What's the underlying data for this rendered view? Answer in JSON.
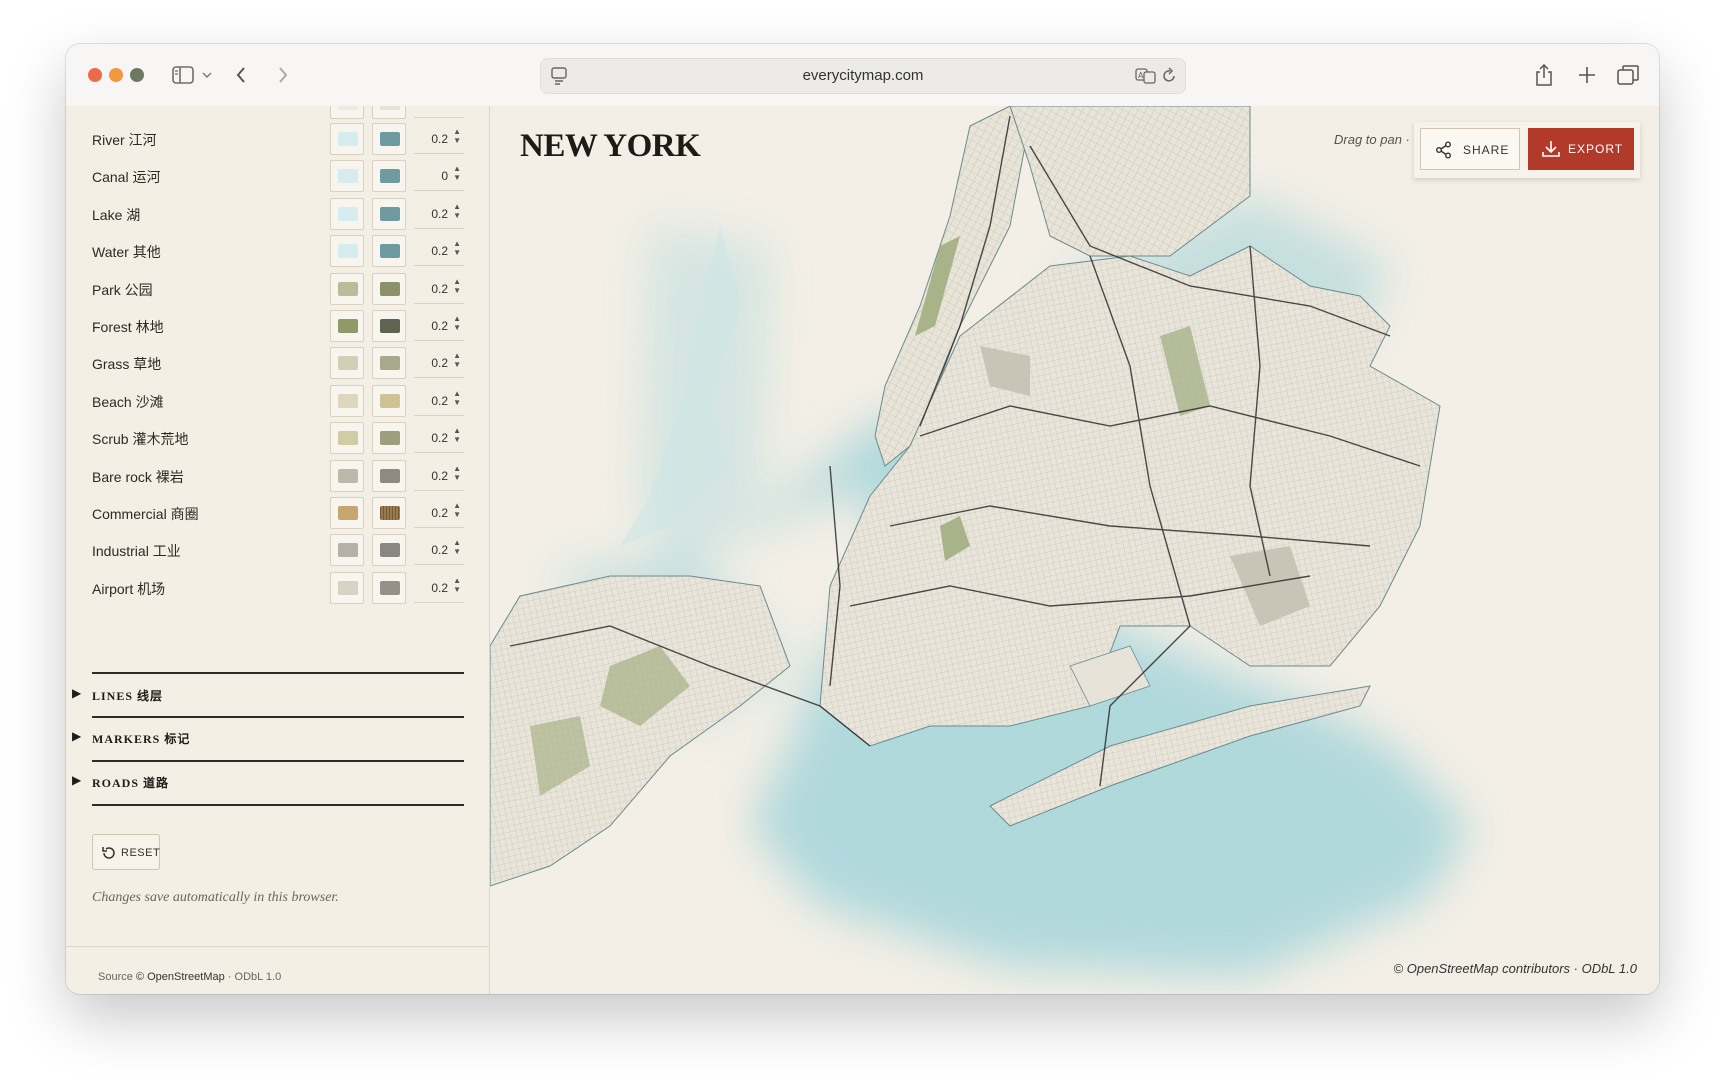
{
  "browser": {
    "url": "everycitymap.com",
    "traffic_colors": [
      "#ee6a4b",
      "#f1993c",
      "#6f7860"
    ]
  },
  "sidebar": {
    "layers": [
      {
        "label": "River 江河",
        "color1": "#d6ecee",
        "color2": "#6f9aa0",
        "value": "0.2"
      },
      {
        "label": "Canal 运河",
        "color1": "#d6ecee",
        "color2": "#6f9aa0",
        "value": "0"
      },
      {
        "label": "Lake 湖",
        "color1": "#d6ecee",
        "color2": "#6f9aa0",
        "value": "0.2"
      },
      {
        "label": "Water 其他",
        "color1": "#d6ecee",
        "color2": "#6f9aa0",
        "value": "0.2"
      },
      {
        "label": "Park 公园",
        "color1": "#b9be98",
        "color2": "#8b9269",
        "value": "0.2"
      },
      {
        "label": "Forest 林地",
        "color1": "#8f9a68",
        "color2": "#5f6350",
        "value": "0.2"
      },
      {
        "label": "Grass 草地",
        "color1": "#d1cfb5",
        "color2": "#a6a98a",
        "value": "0.2"
      },
      {
        "label": "Beach 沙滩",
        "color1": "#dfd6c0",
        "color2": "#cec394",
        "value": "0.2"
      },
      {
        "label": "Scrub 灌木荒地",
        "color1": "#cfcca6",
        "color2": "#9c9e7c",
        "value": "0.2"
      },
      {
        "label": "Bare rock 裸岩",
        "color1": "#bdb8ab",
        "color2": "#8e8a80",
        "value": "0.2"
      },
      {
        "label": "Commercial 商圈",
        "color1": "#c6a671",
        "color2": "#9a7a4c",
        "value": "0.2"
      },
      {
        "label": "Industrial 工业",
        "color1": "#b5b1a8",
        "color2": "#8a8780",
        "value": "0.2"
      },
      {
        "label": "Airport 机场",
        "color1": "#d7d2c4",
        "color2": "#959189",
        "value": "0.2"
      }
    ],
    "sections": [
      {
        "label": "LINES 线层"
      },
      {
        "label": "MARKERS 标记"
      },
      {
        "label": "ROADS 道路"
      }
    ],
    "reset_label": "RESET",
    "note": "Changes save automatically in this browser.",
    "footer": {
      "source_label": "Source",
      "osm": "© OpenStreetMap",
      "license": "· ODbL 1.0"
    }
  },
  "map": {
    "title": "NEW YORK",
    "drag_hint": "Drag to pan ·",
    "share_label": "SHARE",
    "export_label": "EXPORT",
    "attribution": "© OpenStreetMap contributors · ODbL 1.0",
    "colors": {
      "water": "#a9d6db",
      "land": "#e7e3d8",
      "park": "#a9b38a",
      "road": "#2d2d2d",
      "accent": "#b23a2b"
    }
  }
}
